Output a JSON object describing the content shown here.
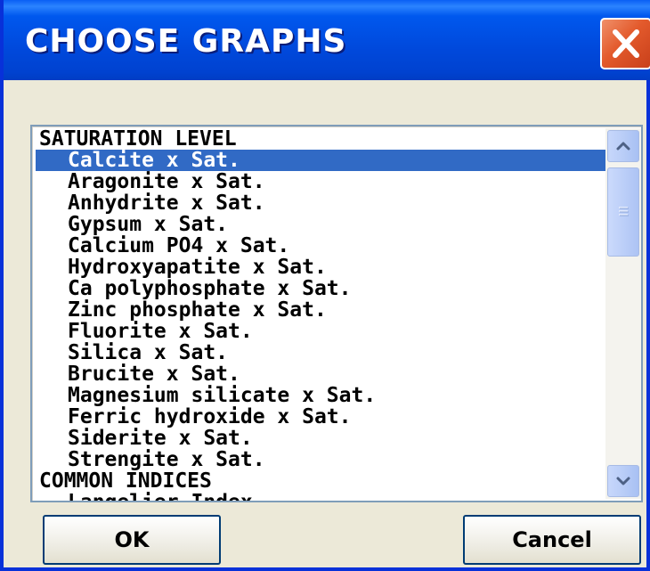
{
  "window": {
    "title": "CHOOSE GRAPHS"
  },
  "list": {
    "items": [
      {
        "label": "SATURATION LEVEL",
        "kind": "header",
        "selected": false
      },
      {
        "label": "Calcite x Sat.",
        "kind": "child",
        "selected": true
      },
      {
        "label": "Aragonite x Sat.",
        "kind": "child",
        "selected": false
      },
      {
        "label": "Anhydrite x Sat.",
        "kind": "child",
        "selected": false
      },
      {
        "label": "Gypsum x Sat.",
        "kind": "child",
        "selected": false
      },
      {
        "label": "Calcium PO4 x Sat.",
        "kind": "child",
        "selected": false
      },
      {
        "label": "Hydroxyapatite x Sat.",
        "kind": "child",
        "selected": false
      },
      {
        "label": "Ca polyphosphate x Sat.",
        "kind": "child",
        "selected": false
      },
      {
        "label": "Zinc phosphate x Sat.",
        "kind": "child",
        "selected": false
      },
      {
        "label": "Fluorite x Sat.",
        "kind": "child",
        "selected": false
      },
      {
        "label": "Silica x Sat.",
        "kind": "child",
        "selected": false
      },
      {
        "label": "Brucite x Sat.",
        "kind": "child",
        "selected": false
      },
      {
        "label": "Magnesium silicate x Sat.",
        "kind": "child",
        "selected": false
      },
      {
        "label": "Ferric hydroxide x Sat.",
        "kind": "child",
        "selected": false
      },
      {
        "label": "Siderite x Sat.",
        "kind": "child",
        "selected": false
      },
      {
        "label": "Strengite x Sat.",
        "kind": "child",
        "selected": false
      },
      {
        "label": "COMMON INDICES",
        "kind": "header",
        "selected": false
      },
      {
        "label": "Langelier Index",
        "kind": "child",
        "selected": false
      }
    ]
  },
  "buttons": {
    "ok_label": "OK",
    "cancel_label": "Cancel"
  },
  "icons": {
    "close": "close-icon",
    "scroll_up": "chevron-up-icon",
    "scroll_down": "chevron-down-icon",
    "thumb_grip": "grip-icon"
  },
  "colors": {
    "titlebar": "#0049dc",
    "selection": "#316ac5",
    "close_button": "#e35a2c",
    "dialog_background": "#ece9d8"
  }
}
